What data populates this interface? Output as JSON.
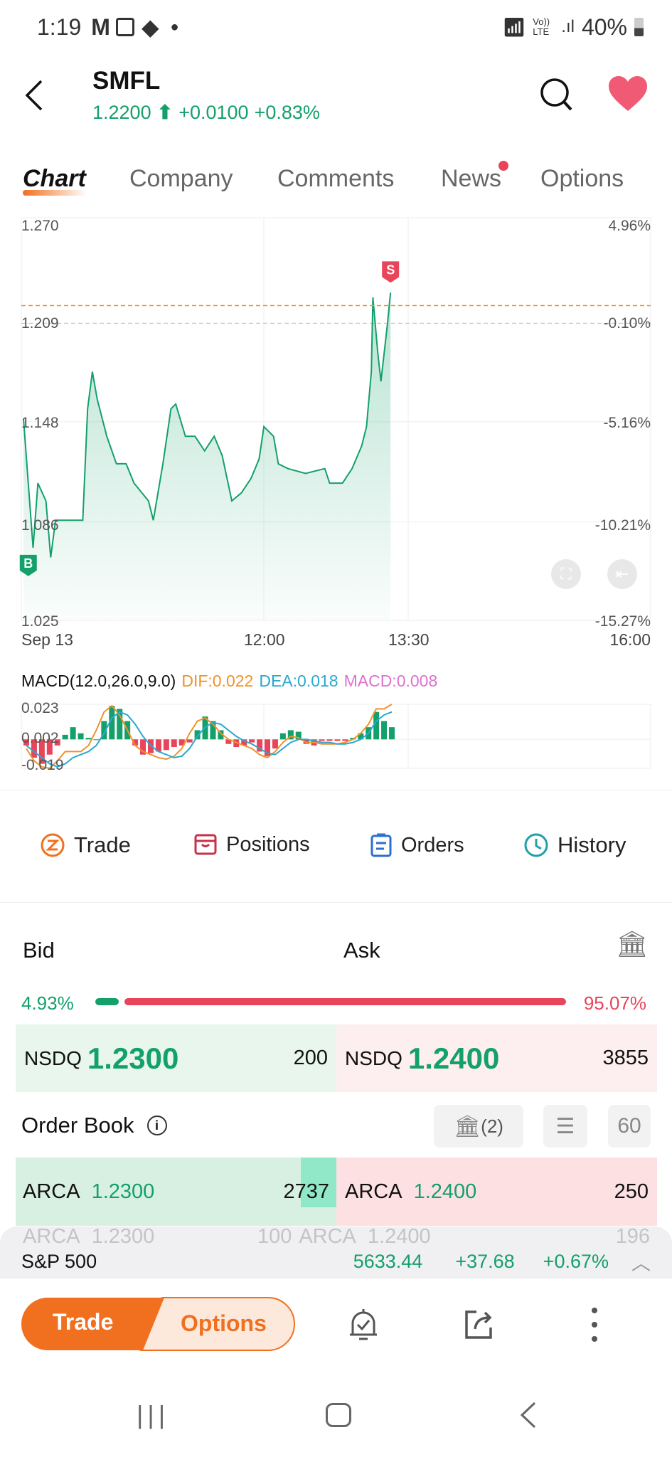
{
  "status_bar": {
    "time": "1:19",
    "battery": "40%",
    "icons": [
      "gmail-icon",
      "gallery-icon",
      "app-icon",
      "dot-icon",
      "wifi-icon",
      "volte-icon",
      "signal-icon",
      "battery-icon"
    ],
    "volte": "Vo)) LTE"
  },
  "header": {
    "symbol": "SMFL",
    "price": "1.2200",
    "change": "+0.0100",
    "change_pct": "+0.83%",
    "direction": "up",
    "favorite": true
  },
  "tabs": [
    {
      "label": "Chart",
      "active": true
    },
    {
      "label": "Company"
    },
    {
      "label": "Comments"
    },
    {
      "label": "News",
      "badge": true
    },
    {
      "label": "Options"
    }
  ],
  "colors": {
    "up": "#13a06a",
    "down": "#e8445a",
    "accent": "#f07020",
    "dif": "#f0922a",
    "dea": "#2aa8d0",
    "macd": "#e070d0"
  },
  "chart_data": [
    {
      "type": "area",
      "ylim": [
        1.025,
        1.27
      ],
      "xlim": [
        "09:30",
        "16:00"
      ],
      "y_ticks": [
        "1.270",
        "1.209",
        "1.148",
        "1.086",
        "1.025"
      ],
      "y2_ticks": [
        "4.96%",
        "-0.10%",
        "-5.16%",
        "-10.21%",
        "-15.27%"
      ],
      "x_ticks": [
        "Sep 13",
        "12:00",
        "13:30",
        "16:00"
      ],
      "prev_close": 1.209,
      "current_price": 1.22,
      "markers": [
        {
          "label": "B",
          "time": "09:33",
          "price": 1.07
        },
        {
          "label": "S",
          "time": "13:19",
          "price": 1.228
        }
      ],
      "points": [
        [
          "09:30",
          1.15
        ],
        [
          "09:36",
          1.07
        ],
        [
          "09:39",
          1.11
        ],
        [
          "09:44",
          1.099
        ],
        [
          "09:47",
          1.064
        ],
        [
          "09:50",
          1.087
        ],
        [
          "10:02",
          1.087
        ],
        [
          "10:07",
          1.087
        ],
        [
          "10:10",
          1.156
        ],
        [
          "10:13",
          1.179
        ],
        [
          "10:16",
          1.162
        ],
        [
          "10:22",
          1.139
        ],
        [
          "10:28",
          1.122
        ],
        [
          "10:34",
          1.122
        ],
        [
          "10:39",
          1.11
        ],
        [
          "10:48",
          1.099
        ],
        [
          "10:51",
          1.087
        ],
        [
          "10:57",
          1.122
        ],
        [
          "11:02",
          1.156
        ],
        [
          "11:05",
          1.159
        ],
        [
          "11:11",
          1.139
        ],
        [
          "11:17",
          1.139
        ],
        [
          "11:23",
          1.13
        ],
        [
          "11:29",
          1.139
        ],
        [
          "11:34",
          1.127
        ],
        [
          "11:40",
          1.099
        ],
        [
          "11:46",
          1.104
        ],
        [
          "11:52",
          1.113
        ],
        [
          "11:57",
          1.125
        ],
        [
          "12:00",
          1.145
        ],
        [
          "12:06",
          1.139
        ],
        [
          "12:09",
          1.122
        ],
        [
          "12:15",
          1.119
        ],
        [
          "12:26",
          1.116
        ],
        [
          "12:38",
          1.119
        ],
        [
          "12:41",
          1.11
        ],
        [
          "12:49",
          1.11
        ],
        [
          "12:55",
          1.119
        ],
        [
          "13:01",
          1.133
        ],
        [
          "13:04",
          1.145
        ],
        [
          "13:07",
          1.179
        ],
        [
          "13:08",
          1.225
        ],
        [
          "13:11",
          1.191
        ],
        [
          "13:13",
          1.173
        ],
        [
          "13:17",
          1.208
        ],
        [
          "13:19",
          1.228
        ]
      ]
    },
    {
      "type": "bar",
      "title": "MACD(12.0,26.0,9.0)",
      "dif_label": "DIF:0.022",
      "dea_label": "DEA:0.018",
      "macd_label": "MACD:0.008",
      "ylim": [
        -0.019,
        0.023
      ],
      "y_ticks": [
        "0.023",
        "0.002",
        "-0.019"
      ],
      "macd": [
        -0.004,
        -0.012,
        -0.016,
        -0.01,
        -0.004,
        0.003,
        0.008,
        0.004,
        0.001,
        0,
        0.012,
        0.022,
        0.02,
        0.012,
        -0.004,
        -0.01,
        -0.009,
        -0.008,
        -0.007,
        -0.005,
        -0.004,
        -0.002,
        0.006,
        0.015,
        0.012,
        0.006,
        -0.003,
        -0.005,
        -0.004,
        -0.002,
        -0.008,
        -0.011,
        -0.006,
        0.004,
        0.006,
        0.005,
        -0.003,
        -0.004,
        -0.001,
        -0.001,
        -0.001,
        -0.001,
        0.001,
        0.004,
        0.008,
        0.018,
        0.012,
        0.008
      ],
      "dif": [
        -0.006,
        -0.014,
        -0.018,
        -0.019,
        -0.014,
        -0.008,
        -0.008,
        -0.008,
        -0.004,
        0.006,
        0.018,
        0.022,
        0.016,
        0.006,
        -0.004,
        -0.008,
        -0.01,
        -0.012,
        -0.013,
        -0.011,
        -0.006,
        0.004,
        0.012,
        0.014,
        0.01,
        0.004,
        0.0,
        -0.002,
        -0.004,
        -0.006,
        -0.01,
        -0.012,
        -0.008,
        -0.002,
        0.002,
        0.001,
        -0.002,
        -0.002,
        -0.003,
        -0.003,
        -0.003,
        -0.002,
        0.0,
        0.004,
        0.01,
        0.02,
        0.02,
        0.023
      ],
      "dea": [
        -0.004,
        -0.008,
        -0.012,
        -0.016,
        -0.018,
        -0.016,
        -0.012,
        -0.01,
        -0.008,
        -0.004,
        0.004,
        0.014,
        0.018,
        0.016,
        0.01,
        0.002,
        -0.004,
        -0.008,
        -0.01,
        -0.012,
        -0.011,
        -0.006,
        0.002,
        0.008,
        0.011,
        0.01,
        0.006,
        0.002,
        -0.001,
        -0.003,
        -0.006,
        -0.009,
        -0.01,
        -0.006,
        -0.002,
        0.0,
        0.0,
        -0.001,
        -0.002,
        -0.002,
        -0.003,
        -0.003,
        -0.002,
        0.0,
        0.004,
        0.012,
        0.016,
        0.018
      ]
    }
  ],
  "actions": [
    {
      "label": "Trade",
      "icon": "trade-icon"
    },
    {
      "label": "Positions",
      "icon": "positions-icon"
    },
    {
      "label": "Orders",
      "icon": "orders-icon"
    },
    {
      "label": "History",
      "icon": "history-icon"
    }
  ],
  "quote": {
    "bid_label": "Bid",
    "ask_label": "Ask",
    "bid_pct": "4.93%",
    "ask_pct": "95.07%",
    "bid_fraction": 0.0493,
    "bid": {
      "exchange": "NSDQ",
      "price": "1.2300",
      "size": "200"
    },
    "ask": {
      "exchange": "NSDQ",
      "price": "1.2400",
      "size": "3855"
    }
  },
  "order_book": {
    "title": "Order Book",
    "exchanges_btn": "(2)",
    "depth": "60",
    "rows": [
      {
        "bid_ex": "ARCA",
        "bid_price": "1.2300",
        "bid_size": "2737",
        "ask_ex": "ARCA",
        "ask_price": "1.2400",
        "ask_size": "250"
      },
      {
        "bid_ex": "ARCA",
        "bid_price": "1.2300",
        "bid_size": "100",
        "ask_ex": "ARCA",
        "ask_price": "1.2400",
        "ask_size": "196"
      }
    ]
  },
  "index_bar": {
    "name": "S&P 500",
    "value": "5633.44",
    "change": "+37.68",
    "change_pct": "+0.67%"
  },
  "bottom": {
    "trade": "Trade",
    "options": "Options"
  }
}
